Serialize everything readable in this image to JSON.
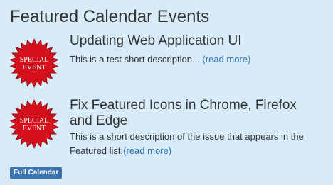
{
  "widget": {
    "title": "Featured Calendar Events"
  },
  "events": [
    {
      "title": "Updating Web Application UI",
      "description": "This is a test short description... ",
      "read_more": "(read more)",
      "badge_line1": "SPECIAL",
      "badge_line2": "EVENT",
      "badge_icon": "special-event-starburst"
    },
    {
      "title": "Fix Featured Icons in Chrome, Firefox and Edge",
      "description": "This is a short description of the issue that appears in the Featured list.",
      "read_more": "(read more)",
      "badge_line1": "SPECIAL",
      "badge_line2": "EVENT",
      "badge_icon": "special-event-starburst"
    }
  ],
  "actions": {
    "full_calendar": "Full Calendar"
  },
  "colors": {
    "background": "#d7ecf8",
    "link": "#2a6fb4",
    "button": "#3a74b3",
    "badge_red": "#d4111a"
  }
}
